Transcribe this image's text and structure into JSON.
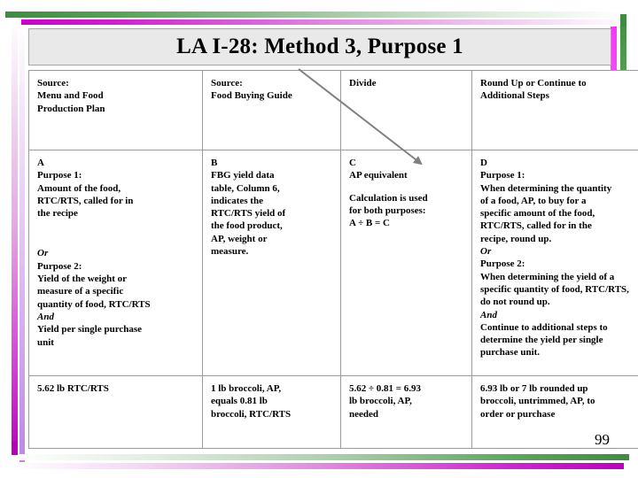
{
  "slide": {
    "title": "LA I-28: Method 3, Purpose 1",
    "page_number": "99",
    "accent_green": "#3f8b3f",
    "accent_magenta": "#cc00cc",
    "title_background": "#e9e9e9",
    "arrow_color": "#808080"
  },
  "table": {
    "header": {
      "col1_l1": "Source:",
      "col1_l2": "Menu and Food",
      "col1_l3": "Production Plan",
      "col2_l1": "Source:",
      "col2_l2": "Food Buying Guide",
      "col3_l1": "Divide",
      "col4_l1": "Round Up or Continue to",
      "col4_l2": "Additional Steps"
    },
    "detail": {
      "col1_label": "A",
      "col1_p1_title": "Purpose 1:",
      "col1_p1_l1": "Amount of the food,",
      "col1_p1_l2": "RTC/RTS, called for in",
      "col1_p1_l3": "the recipe",
      "col1_or": "Or",
      "col1_p2_title": "Purpose 2:",
      "col1_p2_l1": "Yield of the weight or",
      "col1_p2_l2": "measure of a specific",
      "col1_p2_l3": "quantity of food, RTC/RTS",
      "col1_and": "And",
      "col1_p3_l1": "Yield per single  purchase",
      "col1_p3_l2": "unit",
      "col2_label": "B",
      "col2_l1": "FBG yield data",
      "col2_l2": "table, Column 6,",
      "col2_l3": "indicates the",
      "col2_l4": "RTC/RTS yield of",
      "col2_l5": "the food product,",
      "col2_l6": "AP, weight or",
      "col2_l7": "measure.",
      "col3_label": "C",
      "col3_l1": "AP equivalent",
      "col3_l2": "Calculation is used",
      "col3_l3": "for both purposes:",
      "col3_l4": "A ÷ B = C",
      "col4_label": "D",
      "col4_p1_title": "Purpose 1:",
      "col4_p1_l1": "When determining the quantity",
      "col4_p1_l2": "of a food, AP, to buy for a",
      "col4_p1_l3": "specific amount of the food,",
      "col4_p1_l4": "RTC/RTS, called for in the",
      "col4_p1_l5": "recipe, round up.",
      "col4_or": "Or",
      "col4_p2_title": "Purpose 2:",
      "col4_p2_l1": "When determining the yield of a",
      "col4_p2_l2": "specific quantity of food, RTC/RTS,",
      "col4_p2_l3": "do not round up.",
      "col4_and": "And",
      "col4_p3_l1": "Continue to additional steps to",
      "col4_p3_l2": "determine the yield per single",
      "col4_p3_l3": "purchase unit."
    },
    "example": {
      "col1_l1": "5.62 lb RTC/RTS",
      "col2_l1": "1 lb broccoli, AP,",
      "col2_l2": "equals 0.81 lb",
      "col2_l3": "broccoli, RTC/RTS",
      "col3_l1": "5.62 ÷ 0.81 = 6.93",
      "col3_l2": "lb broccoli, AP,",
      "col3_l3": "needed",
      "col4_l1": "6.93 lb or 7 lb rounded up",
      "col4_l2": "broccoli, untrimmed, AP, to",
      "col4_l3": "order or purchase"
    }
  }
}
